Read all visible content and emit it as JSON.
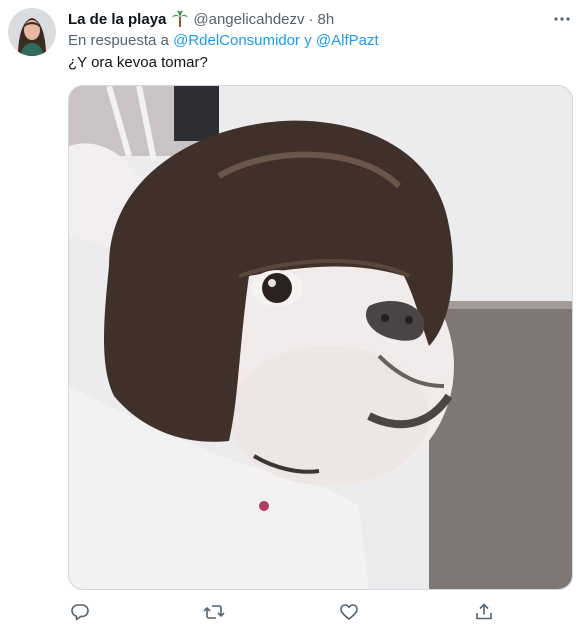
{
  "tweet": {
    "author_name": "La de la playa",
    "author_emoji": "palm-tree-icon",
    "handle": "@angelicahdezv",
    "separator": "·",
    "time": "8h",
    "reply_prefix": "En respuesta a",
    "reply_user_1": "@RdelConsumidor",
    "reply_joiner": "y",
    "reply_user_2": "@AlfPazt",
    "text": "¿Y ora kevoa tomar?"
  },
  "media": {
    "description_icon": "dog-with-wig-photo"
  },
  "actions": [
    "reply-icon",
    "retweet-icon",
    "like-icon",
    "share-icon"
  ],
  "colors": {
    "link": "#1d9bf0",
    "secondary": "#536471",
    "text": "#0f1419",
    "border": "#cfd9de"
  }
}
